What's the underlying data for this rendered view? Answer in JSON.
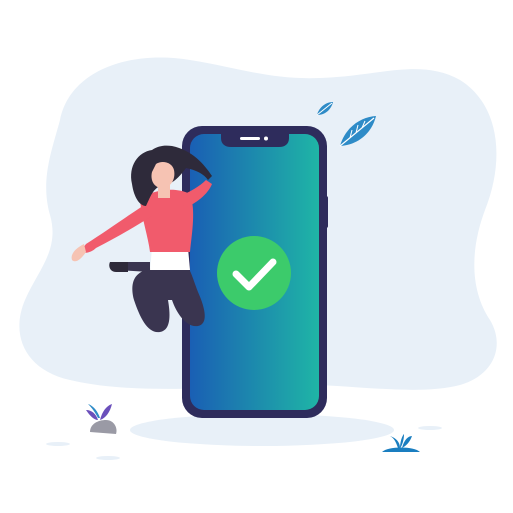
{
  "illustration": {
    "status": "success",
    "icons": [
      "check-icon",
      "leaf-icon",
      "plant-icon",
      "rock-icon"
    ],
    "colors": {
      "background_blob": "#E8F0F8",
      "phone_frame": "#2E2C5C",
      "screen_gradient_start": "#1A5FB4",
      "screen_gradient_end": "#1FB5A6",
      "check_badge": "#3CCB6B",
      "leaf": "#2E8BC7",
      "shirt": "#F15B6C",
      "hair": "#2E2A3A",
      "pants": "#3A3550",
      "skin": "#F6C3B3"
    }
  }
}
